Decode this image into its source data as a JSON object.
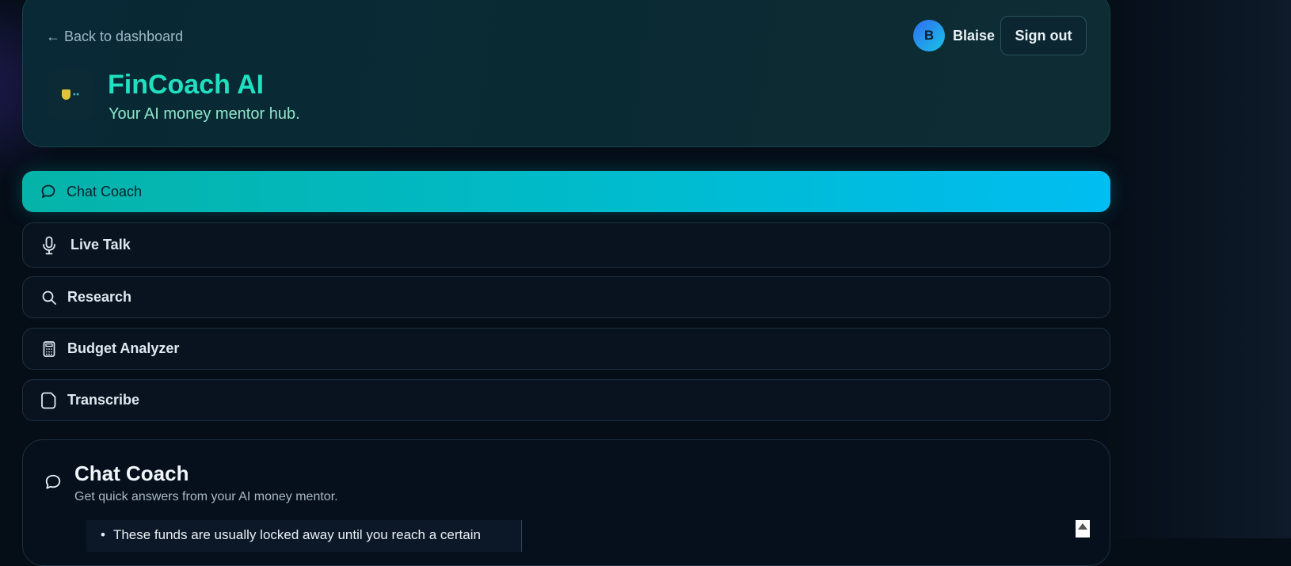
{
  "header": {
    "back_link": "← Back to dashboard",
    "user": {
      "initial": "B",
      "name": "Blaise"
    },
    "sign_out_label": "Sign out",
    "app_title": "FinCoach AI",
    "app_subtitle": "Your AI money mentor hub."
  },
  "nav": {
    "items": [
      {
        "label": "Chat Coach",
        "icon": "chat-bubble-icon",
        "active": true
      },
      {
        "label": "Live Talk",
        "icon": "microphone-icon",
        "active": false
      },
      {
        "label": "Research",
        "icon": "search-icon",
        "active": false
      },
      {
        "label": "Budget Analyzer",
        "icon": "calculator-icon",
        "active": false
      },
      {
        "label": "Transcribe",
        "icon": "file-icon",
        "active": false
      }
    ]
  },
  "content": {
    "title": "Chat Coach",
    "subtitle": "Get quick answers from your AI money mentor.",
    "message_bullet": "These funds are usually locked away until you reach a certain"
  },
  "colors": {
    "accent_teal": "#1fe0c0",
    "active_gradient_start": "#05b3a8",
    "active_gradient_end": "#00bdf2",
    "background": "#050d17"
  }
}
